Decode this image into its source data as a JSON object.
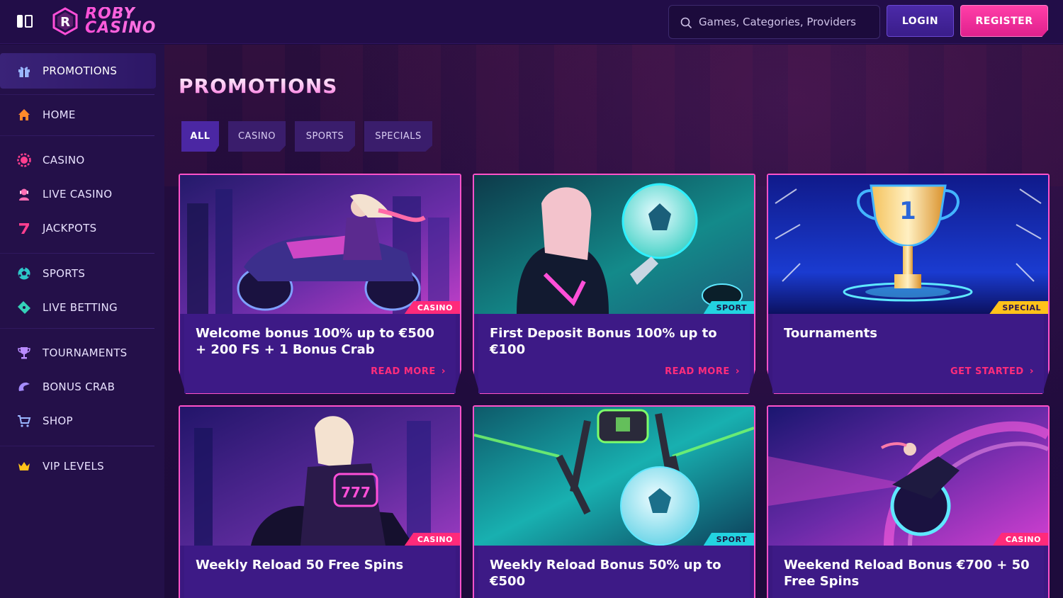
{
  "header": {
    "logo_line1": "ROBY",
    "logo_line2": "CASINO",
    "search_placeholder": "Games, Categories, Providers",
    "login_label": "LOGIN",
    "register_label": "REGISTER"
  },
  "sidebar": {
    "items": [
      {
        "label": "PROMOTIONS",
        "icon": "gift-icon"
      },
      {
        "label": "HOME",
        "icon": "home-icon"
      },
      {
        "label": "CASINO",
        "icon": "casino-chip-icon"
      },
      {
        "label": "LIVE CASINO",
        "icon": "dealer-icon"
      },
      {
        "label": "JACKPOTS",
        "icon": "seven-icon"
      },
      {
        "label": "SPORTS",
        "icon": "soccer-ball-icon"
      },
      {
        "label": "LIVE BETTING",
        "icon": "ticket-icon"
      },
      {
        "label": "TOURNAMENTS",
        "icon": "trophy-icon"
      },
      {
        "label": "BONUS CRAB",
        "icon": "crab-claw-icon"
      },
      {
        "label": "SHOP",
        "icon": "cart-icon"
      },
      {
        "label": "VIP LEVELS",
        "icon": "crown-icon"
      }
    ]
  },
  "main": {
    "title": "PROMOTIONS",
    "tabs": [
      {
        "label": "ALL"
      },
      {
        "label": "CASINO"
      },
      {
        "label": "SPORTS"
      },
      {
        "label": "SPECIALS"
      }
    ],
    "cards": [
      {
        "tag": "CASINO",
        "title": "Welcome bonus 100% up to €500 + 200 FS + 1 Bonus Crab",
        "cta": "READ MORE"
      },
      {
        "tag": "SPORT",
        "title": "First Deposit Bonus 100% up to €100",
        "cta": "READ MORE"
      },
      {
        "tag": "SPECIAL",
        "title": "Tournaments",
        "cta": "GET STARTED"
      },
      {
        "tag": "CASINO",
        "title": "Weekly Reload 50 Free Spins",
        "cta": ""
      },
      {
        "tag": "SPORT",
        "title": "Weekly Reload Bonus 50% up to €500",
        "cta": ""
      },
      {
        "tag": "CASINO",
        "title": "Weekend Reload Bonus €700 + 50 Free Spins",
        "cta": ""
      }
    ]
  },
  "colors": {
    "accent_pink": "#ff2d7b",
    "border_pink": "#ff52c9",
    "tag_sport": "#23d3e0",
    "tag_special": "#ffc21a",
    "login_bg": "#4b2aa8"
  }
}
